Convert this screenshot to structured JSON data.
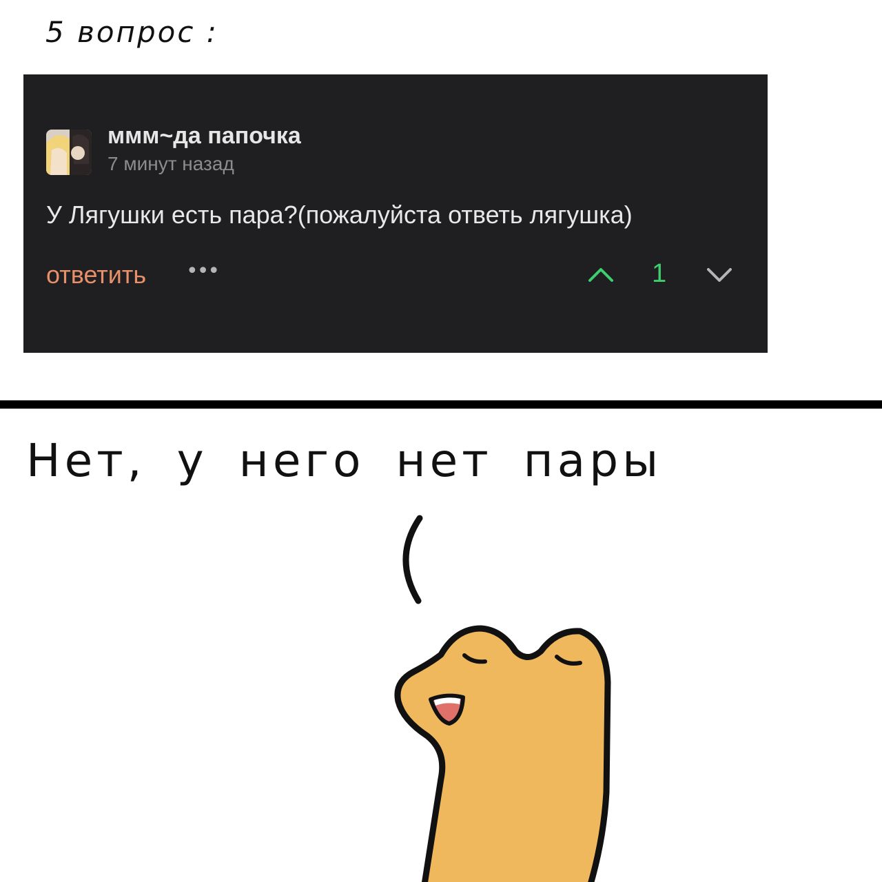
{
  "top_caption": "5 вопрос :",
  "comment": {
    "author": "ммм~да папочка",
    "time": "7 минут назад",
    "text": "У Лягушки есть пара?(пожалуйста ответь лягушка)",
    "reply_label": "ответить",
    "more_label": "•••",
    "score": "1",
    "colors": {
      "background": "#1f1f21",
      "reply": "#e8906a",
      "vote": "#3fcf6e",
      "downvote": "#b5b5b5"
    },
    "icons": {
      "upvote": "chevron-up-icon",
      "downvote": "chevron-down-icon",
      "more": "more-dots-icon"
    }
  },
  "bottom_caption": "Нет, у него нет пары",
  "frog_color": "#f0b85c"
}
